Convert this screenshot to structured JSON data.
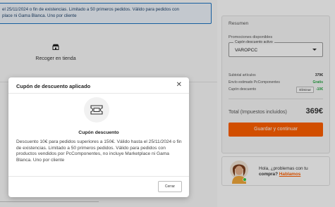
{
  "page": {
    "promo_banner_text": "el 25/11/2024 o fin de existencias. Limitado a 50 primeros pedidos. Válido para pedidos con",
    "promo_banner_text2": "place ni Gama Blanca. Uno por cliente",
    "pickup_label": "Recoger en tienda"
  },
  "summary": {
    "title": "Resumen",
    "promotions_title": "Promociones disponibles",
    "coupon_legend": "Cupón descuento activo",
    "coupon_value": "VAROPCC",
    "rows": [
      {
        "label": "Subtotal artículos",
        "value": "379€"
      },
      {
        "label": "Envío estimado PcComponentes",
        "value": "Gratis"
      },
      {
        "label": "Cupón descuento",
        "button": "Eliminar",
        "value": "-10€"
      }
    ],
    "total_label": "Total (Impuestos incluidos)",
    "total_value": "369€",
    "checkout_label": "Guardar y continuar"
  },
  "help": {
    "line1": "Hola, ¿problemas con tu",
    "line2": "compra?",
    "link": "Hablamos"
  },
  "modal": {
    "title": "Cupón de descuento aplicado",
    "close_icon": "close-icon",
    "icon": "ticket-icon",
    "subtitle": "Cupón descuento",
    "description": "Descuento 10€ para pedidos superiores a 150€. Válido hasta el 25/11/2024 o fin de existencias. Limitado a 50 primeros pedidos. Válido para pedidos con productos vendidos por PcComponentes, no incluye Marketplace ni Gama Blanca. Uno por cliente",
    "close_button": "Cerrar"
  },
  "colors": {
    "accent": "#ff6000",
    "success": "#28a745",
    "banner_border": "#1d75c4"
  }
}
